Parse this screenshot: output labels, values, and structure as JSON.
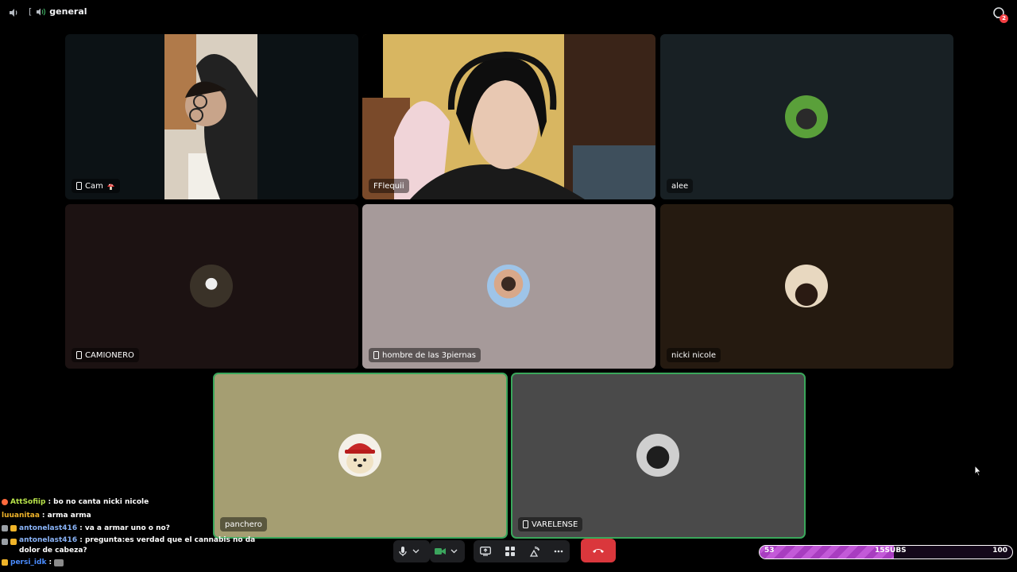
{
  "topbar": {
    "channel": "general",
    "open_bracket": "[",
    "inbox_badge": "2"
  },
  "tiles": [
    {
      "name": "Cam",
      "suffix_icon": "mushroom-icon",
      "mobile": true,
      "kind": "video",
      "bg": "#0c1215"
    },
    {
      "name": "FFlequii",
      "mobile": false,
      "kind": "video",
      "bg": "#2b2015"
    },
    {
      "name": "alee",
      "mobile": false,
      "kind": "avatar",
      "bg": "#182024"
    },
    {
      "name": "CAMIONERO",
      "mobile": true,
      "kind": "avatar",
      "bg": "#1c1212"
    },
    {
      "name": "hombre de las 3piernas",
      "mobile": true,
      "kind": "avatar",
      "bg": "#a69a9a"
    },
    {
      "name": "nicki nicole",
      "mobile": false,
      "kind": "avatar",
      "bg": "#251a10"
    },
    {
      "name": "panchero",
      "mobile": false,
      "kind": "avatar",
      "bg": "#a59e72",
      "speaking": true
    },
    {
      "name": "VARELENSE",
      "mobile": true,
      "kind": "avatar",
      "bg": "#4a4a4a",
      "speaking": true
    }
  ],
  "chat": [
    {
      "user": "AttSofiip",
      "user_color": "#b8e34a",
      "text": ": bo no canta nicki nicole",
      "badges": [
        "#ff6a3d"
      ]
    },
    {
      "user": "luuanitaa",
      "user_color": "#f0b429",
      "text": ": arma arma",
      "badges": []
    },
    {
      "user": "antonelast416",
      "user_color": "#8ab4f8",
      "text": ": va a armar uno o no?",
      "badges": [
        "#9aa0a6",
        "#f0b429"
      ]
    },
    {
      "user": "antonelast416",
      "user_color": "#8ab4f8",
      "text": ": pregunta:es verdad que el cannabis no da dolor de cabeza?",
      "badges": [
        "#9aa0a6",
        "#f0b429"
      ]
    },
    {
      "user": "persi_idk",
      "user_color": "#4a8cff",
      "text": ":",
      "badges": [
        "#f0b429"
      ],
      "emote": "cat-emote"
    }
  ],
  "controls": {
    "mic": "microphone-icon",
    "camera": "camera-icon",
    "share": "screen-share-icon",
    "activities": "activities-icon",
    "soundboard": "soundboard-icon",
    "more": "more-icon",
    "leave": "hang-up-icon"
  },
  "subgoal": {
    "current": "53",
    "label": "15SUBS",
    "target": "100",
    "progress": 0.53,
    "fill_color": "#c35ad8"
  }
}
